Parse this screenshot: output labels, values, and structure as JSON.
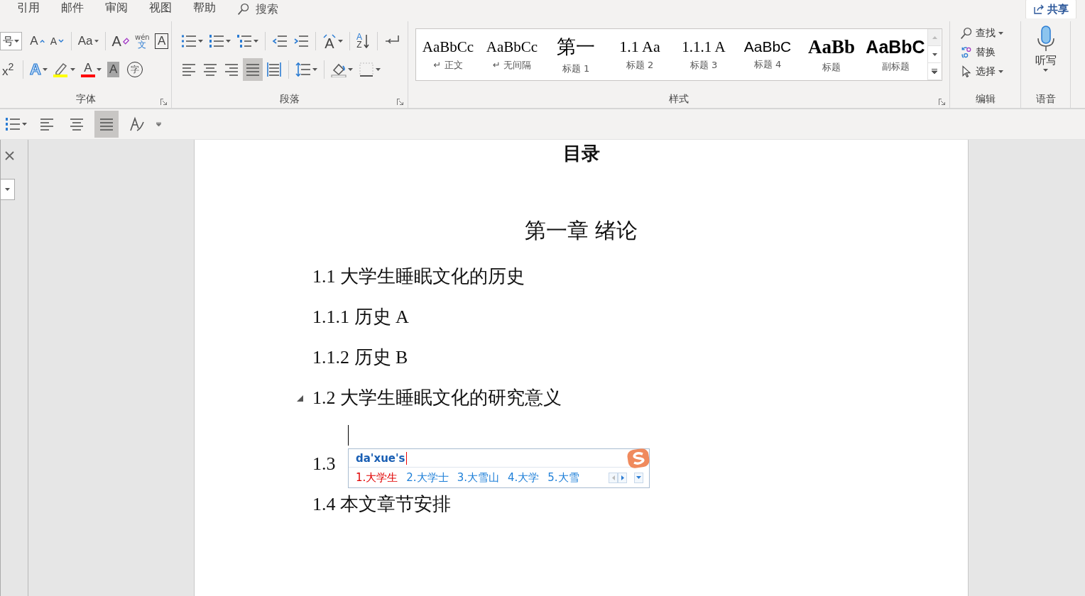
{
  "menu_tabs": [
    {
      "label": "引用",
      "selected": false
    },
    {
      "label": "邮件",
      "selected": false
    },
    {
      "label": "审阅",
      "selected": false
    },
    {
      "label": "视图",
      "selected": false
    },
    {
      "label": "帮助",
      "selected": false
    }
  ],
  "search": {
    "placeholder": "搜索"
  },
  "share_button": {
    "label": "共享"
  },
  "font_group": {
    "label": "字体",
    "size_field": {
      "value": "号"
    },
    "row1": [
      {
        "kind": "grow",
        "glyph": "A"
      },
      {
        "kind": "shrink",
        "glyph": "A"
      },
      {
        "kind": "sep"
      },
      {
        "kind": "text",
        "glyph": "Aa",
        "dropdown": true
      },
      {
        "kind": "sep"
      },
      {
        "kind": "clear",
        "glyph": "A"
      },
      {
        "kind": "phonetic",
        "glyph": "wén",
        "glyph2": "文"
      },
      {
        "kind": "boxed",
        "glyph": "A"
      }
    ],
    "row2": [
      {
        "kind": "text",
        "glyph": "x$^{2}$"
      },
      {
        "kind": "sep"
      },
      {
        "kind": "effect",
        "glyph": "A",
        "dropdown": true
      },
      {
        "kind": "highlight",
        "color": "#ffff00",
        "dropdown": true
      },
      {
        "kind": "fontcolor",
        "glyph": "A",
        "color": "#ff0000",
        "dropdown": true
      },
      {
        "kind": "shaded",
        "glyph": "A"
      },
      {
        "kind": "circled",
        "glyph": "字"
      }
    ]
  },
  "paragraph_group": {
    "label": "段落",
    "row1": [
      {
        "kind": "bullets",
        "dropdown": true
      },
      {
        "kind": "numbering",
        "dropdown": true
      },
      {
        "kind": "multilevel",
        "dropdown": true
      },
      {
        "kind": "sep"
      },
      {
        "kind": "outdent"
      },
      {
        "kind": "indent"
      },
      {
        "kind": "sep"
      },
      {
        "kind": "direction",
        "glyph": "A",
        "dropdown": true
      },
      {
        "kind": "sep"
      },
      {
        "kind": "sort",
        "glyph": "A",
        "glyph2": "Z"
      },
      {
        "kind": "sep"
      },
      {
        "kind": "enter"
      }
    ],
    "row2": [
      {
        "kind": "align-left",
        "selected": false
      },
      {
        "kind": "align-center",
        "selected": false
      },
      {
        "kind": "align-right",
        "selected": false
      },
      {
        "kind": "justify",
        "selected": true
      },
      {
        "kind": "distributed",
        "selected": false
      },
      {
        "kind": "sep"
      },
      {
        "kind": "line-spacing",
        "dropdown": true
      },
      {
        "kind": "sep"
      },
      {
        "kind": "shading",
        "dropdown": true
      },
      {
        "kind": "borders",
        "dropdown": true
      }
    ]
  },
  "styles_group": {
    "label": "样式",
    "items": [
      {
        "preview": "AaBbCc",
        "name": "正文",
        "para_mark": "↵",
        "kind": "serif"
      },
      {
        "preview": "AaBbCc",
        "name": "无间隔",
        "para_mark": "↵",
        "kind": "serif"
      },
      {
        "preview": "第一",
        "name": "标题 1",
        "kind": "cjk-large"
      },
      {
        "preview": "1.1 Aa",
        "name": "标题 2",
        "kind": "serif-light"
      },
      {
        "preview": "1.1.1 A",
        "name": "标题 3",
        "kind": "serif"
      },
      {
        "preview": "AaBbC",
        "name": "标题 4",
        "kind": "sans"
      },
      {
        "preview": "AaBb",
        "name": "标题",
        "kind": "serif-bold"
      },
      {
        "preview": "AaBbC",
        "name": "副标题",
        "kind": "sans-bold"
      }
    ]
  },
  "editing_group": {
    "label": "编辑",
    "items": [
      {
        "kind": "find",
        "label": "查找",
        "dropdown": true
      },
      {
        "kind": "replace",
        "label": "替换",
        "dropdown": false
      },
      {
        "kind": "select",
        "label": "选择",
        "dropdown": true
      }
    ]
  },
  "voice_group": {
    "label": "语音",
    "dictate": {
      "label": "听写"
    }
  },
  "quick_toolbar": [
    {
      "kind": "numbering",
      "dropdown": true
    },
    {
      "kind": "align-left",
      "selected": false
    },
    {
      "kind": "align-center",
      "selected": false
    },
    {
      "kind": "justify",
      "selected": true
    },
    {
      "kind": "style-pen"
    },
    {
      "kind": "overflow"
    }
  ],
  "document": {
    "title": "目录",
    "chapter": "第一章 绪论",
    "toc": [
      {
        "text": "1.1 大学生睡眠文化的历史",
        "collapse_arrow": false,
        "cursor_after": false
      },
      {
        "text": "1.1.1 历史 A",
        "collapse_arrow": false,
        "cursor_after": false
      },
      {
        "text": "1.1.2 历史 B",
        "collapse_arrow": false,
        "cursor_after": false
      },
      {
        "text": "1.2 大学生睡眠文化的研究意义",
        "collapse_arrow": true,
        "cursor_after": true
      },
      {
        "text": "1.3",
        "collapse_arrow": false,
        "cursor_after": false
      },
      {
        "text": "1.4 本文章节安排",
        "collapse_arrow": false,
        "cursor_after": false
      }
    ]
  },
  "ime": {
    "input": "da'xue's",
    "candidates": [
      {
        "label": "1.大学生",
        "selected": true
      },
      {
        "label": "2.大学士",
        "selected": false
      },
      {
        "label": "3.大雪山",
        "selected": false
      },
      {
        "label": "4.大学",
        "selected": false
      },
      {
        "label": "5.大雪",
        "selected": false
      }
    ]
  }
}
